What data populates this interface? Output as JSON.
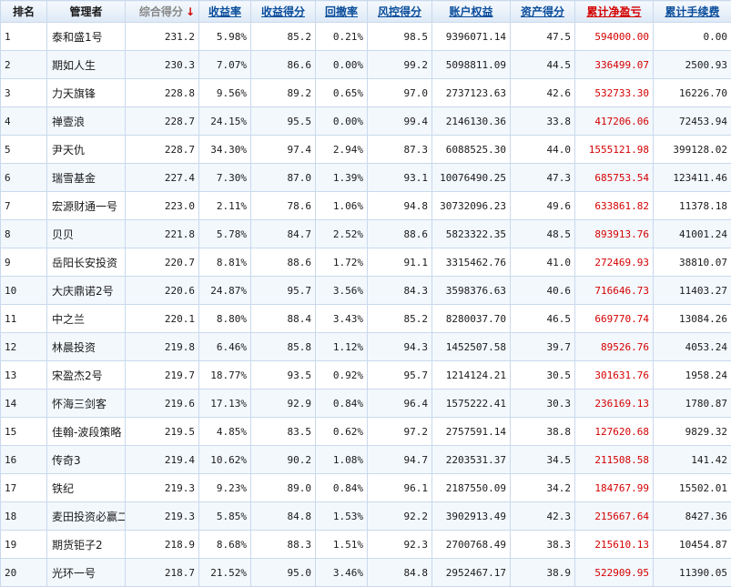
{
  "headers": [
    "排名",
    "管理者",
    "综合得分",
    "收益率",
    "收益得分",
    "回撤率",
    "风控得分",
    "账户权益",
    "资产得分",
    "累计净盈亏",
    "累计手续费"
  ],
  "sort_icon": "arrow-down-icon",
  "sort_arrow": "↓",
  "colors": {
    "header_link": "#0a4d9b",
    "profit": "#d40000",
    "border": "#c9d9ec",
    "row_alt": "#f3f8fd"
  },
  "rows": [
    [
      "1",
      "泰和盛1号",
      "231.2",
      "5.98%",
      "85.2",
      "0.21%",
      "98.5",
      "9396071.14",
      "47.5",
      "594000.00",
      "0.00"
    ],
    [
      "2",
      "期如人生",
      "230.3",
      "7.07%",
      "86.6",
      "0.00%",
      "99.2",
      "5098811.09",
      "44.5",
      "336499.07",
      "2500.93"
    ],
    [
      "3",
      "力天旗锋",
      "228.8",
      "9.56%",
      "89.2",
      "0.65%",
      "97.0",
      "2737123.63",
      "42.6",
      "532733.30",
      "16226.70"
    ],
    [
      "4",
      "禅壹浪",
      "228.7",
      "24.15%",
      "95.5",
      "0.00%",
      "99.4",
      "2146130.36",
      "33.8",
      "417206.06",
      "72453.94"
    ],
    [
      "5",
      "尹天仇",
      "228.7",
      "34.30%",
      "97.4",
      "2.94%",
      "87.3",
      "6088525.30",
      "44.0",
      "1555121.98",
      "399128.02"
    ],
    [
      "6",
      "瑞雪基金",
      "227.4",
      "7.30%",
      "87.0",
      "1.39%",
      "93.1",
      "10076490.25",
      "47.3",
      "685753.54",
      "123411.46"
    ],
    [
      "7",
      "宏源财通一号",
      "223.0",
      "2.11%",
      "78.6",
      "1.06%",
      "94.8",
      "30732096.23",
      "49.6",
      "633861.82",
      "11378.18"
    ],
    [
      "8",
      "贝贝",
      "221.8",
      "5.78%",
      "84.7",
      "2.52%",
      "88.6",
      "5823322.35",
      "48.5",
      "893913.76",
      "41001.24"
    ],
    [
      "9",
      "岳阳长安投资",
      "220.7",
      "8.81%",
      "88.6",
      "1.72%",
      "91.1",
      "3315462.76",
      "41.0",
      "272469.93",
      "38810.07"
    ],
    [
      "10",
      "大庆鼎诺2号",
      "220.6",
      "24.87%",
      "95.7",
      "3.56%",
      "84.3",
      "3598376.63",
      "40.6",
      "716646.73",
      "11403.27"
    ],
    [
      "11",
      "中之兰",
      "220.1",
      "8.80%",
      "88.4",
      "3.43%",
      "85.2",
      "8280037.70",
      "46.5",
      "669770.74",
      "13084.26"
    ],
    [
      "12",
      "林晨投资",
      "219.8",
      "6.46%",
      "85.8",
      "1.12%",
      "94.3",
      "1452507.58",
      "39.7",
      "89526.76",
      "4053.24"
    ],
    [
      "13",
      "宋盈杰2号",
      "219.7",
      "18.77%",
      "93.5",
      "0.92%",
      "95.7",
      "1214124.21",
      "30.5",
      "301631.76",
      "1958.24"
    ],
    [
      "14",
      "怀海三剑客",
      "219.6",
      "17.13%",
      "92.9",
      "0.84%",
      "96.4",
      "1575222.41",
      "30.3",
      "236169.13",
      "1780.87"
    ],
    [
      "15",
      "佳翰-波段策略",
      "219.5",
      "4.85%",
      "83.5",
      "0.62%",
      "97.2",
      "2757591.14",
      "38.8",
      "127620.68",
      "9829.32"
    ],
    [
      "16",
      "传奇3",
      "219.4",
      "10.62%",
      "90.2",
      "1.08%",
      "94.7",
      "2203531.37",
      "34.5",
      "211508.58",
      "141.42"
    ],
    [
      "17",
      "铁纪",
      "219.3",
      "9.23%",
      "89.0",
      "0.84%",
      "96.1",
      "2187550.09",
      "34.2",
      "184767.99",
      "15502.01"
    ],
    [
      "18",
      "麦田投资必赢二",
      "219.3",
      "5.85%",
      "84.8",
      "1.53%",
      "92.2",
      "3902913.49",
      "42.3",
      "215667.64",
      "8427.36"
    ],
    [
      "19",
      "期货钜子2",
      "218.9",
      "8.68%",
      "88.3",
      "1.51%",
      "92.3",
      "2700768.49",
      "38.3",
      "215610.13",
      "10454.87"
    ],
    [
      "20",
      "光环一号",
      "218.7",
      "21.52%",
      "95.0",
      "3.46%",
      "84.8",
      "2952467.17",
      "38.9",
      "522909.95",
      "11390.05"
    ]
  ]
}
